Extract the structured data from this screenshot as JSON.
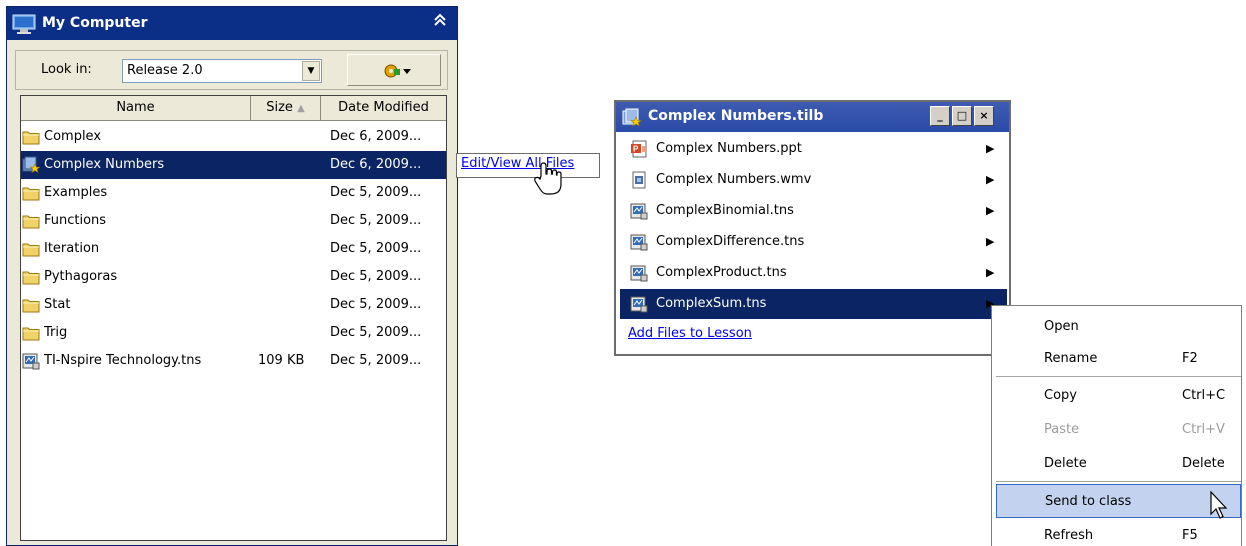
{
  "my_computer": {
    "title": "My Computer",
    "look_in_label": "Look in:",
    "look_in_value": "Release 2.0",
    "columns": {
      "name": "Name",
      "size": "Size",
      "date": "Date Modified"
    },
    "files": [
      {
        "name": "Complex",
        "size": "",
        "date": "Dec 6, 2009...",
        "icon": "folder-icon"
      },
      {
        "name": "Complex Numbers",
        "size": "",
        "date": "Dec 6, 2009...",
        "icon": "lesson-bundle-icon"
      },
      {
        "name": "Examples",
        "size": "",
        "date": "Dec 5, 2009...",
        "icon": "folder-icon"
      },
      {
        "name": "Functions",
        "size": "",
        "date": "Dec 5, 2009...",
        "icon": "folder-icon"
      },
      {
        "name": "Iteration",
        "size": "",
        "date": "Dec 5, 2009...",
        "icon": "folder-icon"
      },
      {
        "name": "Pythagoras",
        "size": "",
        "date": "Dec 5, 2009...",
        "icon": "folder-icon"
      },
      {
        "name": "Stat",
        "size": "",
        "date": "Dec 5, 2009...",
        "icon": "folder-icon"
      },
      {
        "name": "Trig",
        "size": "",
        "date": "Dec 5, 2009...",
        "icon": "folder-icon"
      },
      {
        "name": "TI-Nspire Technology.tns",
        "size": "109 KB",
        "date": "Dec 5, 2009...",
        "icon": "tns-file-icon"
      }
    ],
    "selected_file": "Complex Numbers"
  },
  "tooltip": {
    "link": "Edit/View All Files"
  },
  "lesson_window": {
    "title": "Complex Numbers.tilb",
    "items": [
      {
        "name": "Complex Numbers.ppt",
        "icon": "ppt-file-icon"
      },
      {
        "name": "Complex Numbers.wmv",
        "icon": "video-file-icon"
      },
      {
        "name": "ComplexBinomial.tns",
        "icon": "tns-file-icon"
      },
      {
        "name": "ComplexDifference.tns",
        "icon": "tns-file-icon"
      },
      {
        "name": "ComplexProduct.tns",
        "icon": "tns-file-icon"
      },
      {
        "name": "ComplexSum.tns",
        "icon": "tns-file-icon"
      }
    ],
    "selected_item": "ComplexSum.tns",
    "add_files_link": "Add Files to Lesson"
  },
  "context_menu": {
    "items": [
      {
        "label": "Open",
        "shortcut": ""
      },
      {
        "label": "Rename",
        "shortcut": "F2"
      },
      {
        "label": "Copy",
        "shortcut": "Ctrl+C"
      },
      {
        "label": "Paste",
        "shortcut": "Ctrl+V",
        "disabled": true
      },
      {
        "label": "Delete",
        "shortcut": "Delete"
      },
      {
        "label": "Send to class",
        "shortcut": "",
        "hovered": true
      },
      {
        "label": "Refresh",
        "shortcut": "F5"
      }
    ]
  },
  "colors": {
    "selection": "#0b2463",
    "title_bar": "#0b2f86",
    "menu_hover": "#c3d2ee",
    "link": "#0000ee"
  }
}
